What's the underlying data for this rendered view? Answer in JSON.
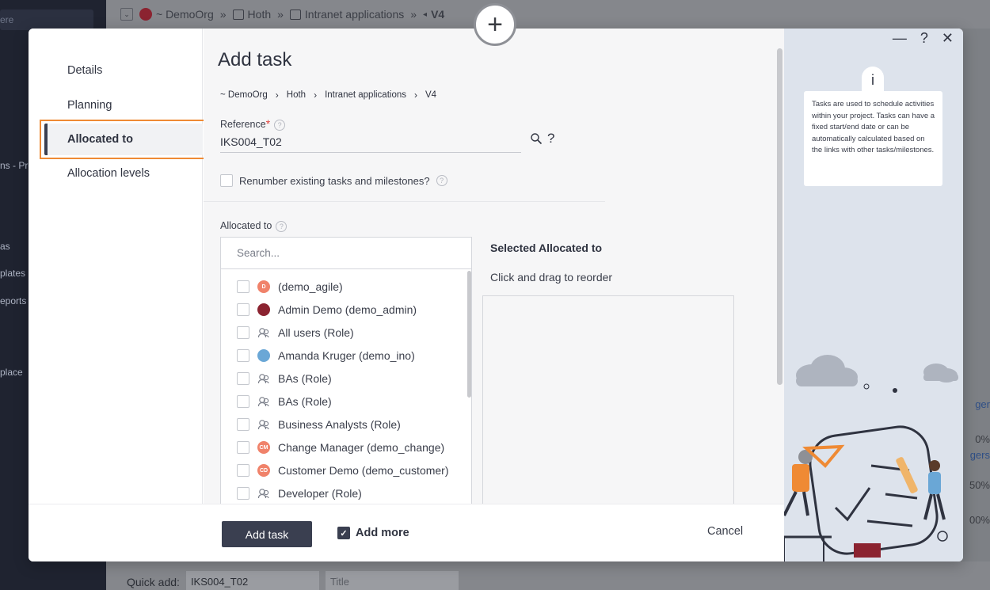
{
  "background": {
    "sidebar_search": "ere",
    "sidebar_items": [
      "ns - Pro",
      "as",
      "plates",
      "eports &",
      "place"
    ],
    "breadcrumb": [
      "~ DemoOrg",
      "Hoth",
      "Intranet applications",
      "V4"
    ],
    "right_fragments": [
      "ger",
      "0%",
      "gers",
      "50%",
      "00%"
    ],
    "quick_add_label": "Quick add:",
    "quick_add_reference": "IKS004_T02",
    "quick_add_title_placeholder": "Title"
  },
  "modal": {
    "nav": {
      "items": [
        "Details",
        "Planning",
        "Allocated to",
        "Allocation levels"
      ],
      "active": "Allocated to"
    },
    "title": "Add task",
    "breadcrumb": [
      "~ DemoOrg",
      "Hoth",
      "Intranet applications",
      "V4"
    ],
    "reference": {
      "label": "Reference",
      "value": "IKS004_T02"
    },
    "renumber_label": "Renumber existing tasks and milestones?",
    "allocated": {
      "label": "Allocated to",
      "search_placeholder": "Search...",
      "items": [
        {
          "name": "(demo_agile)",
          "icon": "avatar-d",
          "initials": "D",
          "color": "#f0826a"
        },
        {
          "name": "Admin Demo (demo_admin)",
          "icon": "avatar-photo",
          "initials": "",
          "color": "#8b2330"
        },
        {
          "name": "All users (Role)",
          "icon": "role-icon",
          "initials": "",
          "color": ""
        },
        {
          "name": "Amanda Kruger (demo_ino)",
          "icon": "avatar-photo",
          "initials": "",
          "color": "#6aa7d6"
        },
        {
          "name": "BAs (Role)",
          "icon": "role-icon",
          "initials": "",
          "color": ""
        },
        {
          "name": "BAs (Role)",
          "icon": "role-icon",
          "initials": "",
          "color": ""
        },
        {
          "name": "Business Analysts (Role)",
          "icon": "role-icon",
          "initials": "",
          "color": ""
        },
        {
          "name": "Change Manager (demo_change)",
          "icon": "avatar-cm",
          "initials": "CM",
          "color": "#f0826a"
        },
        {
          "name": "Customer Demo (demo_customer)",
          "icon": "avatar-cd",
          "initials": "CD",
          "color": "#f0826a"
        },
        {
          "name": "Developer (Role)",
          "icon": "role-icon",
          "initials": "",
          "color": ""
        }
      ]
    },
    "selected": {
      "title": "Selected Allocated to",
      "hint": "Click and drag to reorder"
    },
    "footer": {
      "primary": "Add task",
      "add_more": "Add more",
      "cancel": "Cancel"
    },
    "info": {
      "text": "Tasks are used to schedule activities within your project. Tasks can have a fixed start/end date or can be automatically calculated based on the links with other tasks/milestones."
    },
    "window_controls": [
      "—",
      "?",
      "✕"
    ]
  }
}
